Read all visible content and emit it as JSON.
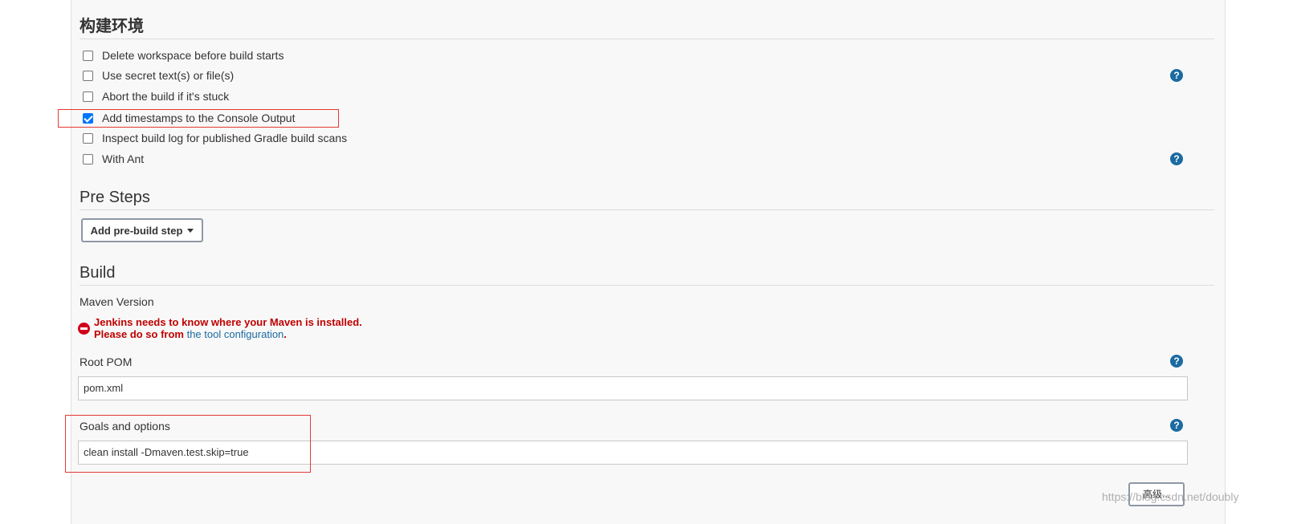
{
  "build_environment": {
    "title": "构建环境",
    "options": [
      {
        "label": "Delete workspace before build starts",
        "checked": false
      },
      {
        "label": "Use secret text(s) or file(s)",
        "checked": false
      },
      {
        "label": "Abort the build if it's stuck",
        "checked": false
      },
      {
        "label": "Add timestamps to the Console Output",
        "checked": true
      },
      {
        "label": "Inspect build log for published Gradle build scans",
        "checked": false
      },
      {
        "label": "With Ant",
        "checked": false
      }
    ],
    "help_icon": "?"
  },
  "pre_steps": {
    "title": "Pre Steps",
    "add_button": "Add pre-build step"
  },
  "build": {
    "title": "Build",
    "maven_version_label": "Maven Version",
    "error_line1": "Jenkins needs to know where your Maven is installed.",
    "error_line2_prefix": "Please do so from ",
    "error_link": "the tool configuration",
    "error_line2_suffix": ".",
    "root_pom_label": "Root POM",
    "root_pom_value": "pom.xml",
    "goals_label": "Goals and options",
    "goals_value": "clean install -Dmaven.test.skip=true",
    "advanced_button": "高级..."
  },
  "watermark": "https://blog.csdn.net/doubly",
  "colors": {
    "highlight_box": "#e53935",
    "help_icon": "#1a6ba1",
    "error_text": "#c00000",
    "link": "#1a6ba1"
  },
  "icons": [
    "help-icon",
    "error-icon",
    "caret-down-icon"
  ]
}
